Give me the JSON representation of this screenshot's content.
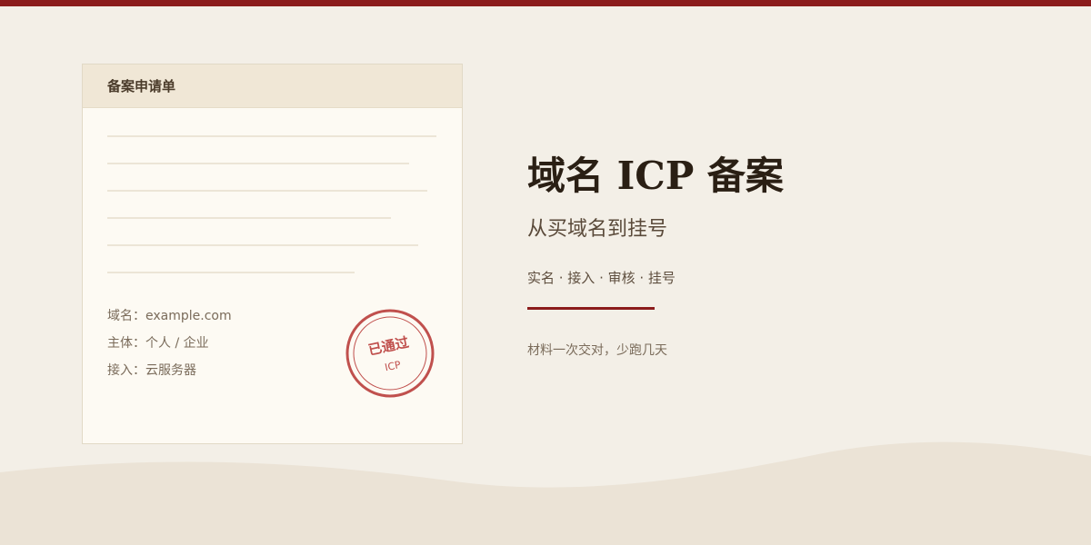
{
  "card": {
    "title": "备案申请单",
    "fields": [
      {
        "label": "域名：",
        "value": "example.com"
      },
      {
        "label": "主体：",
        "value": "个人 / 企业"
      },
      {
        "label": "接入：",
        "value": "云服务器"
      }
    ],
    "stamp": {
      "text": "已通过",
      "sub": "ICP",
      "color": "#c0504d"
    }
  },
  "hero": {
    "title": "域名 ICP 备案",
    "subtitle": "从买域名到挂号",
    "steps": "实名 · 接入 · 审核 · 挂号",
    "tagline": "材料一次交对，少跑几天"
  },
  "colors": {
    "accent": "#8b1c1c",
    "background": "#f3efe7",
    "card_background": "#fdfaf3",
    "card_header": "#f0e7d6",
    "wave": "#ebe3d6"
  }
}
